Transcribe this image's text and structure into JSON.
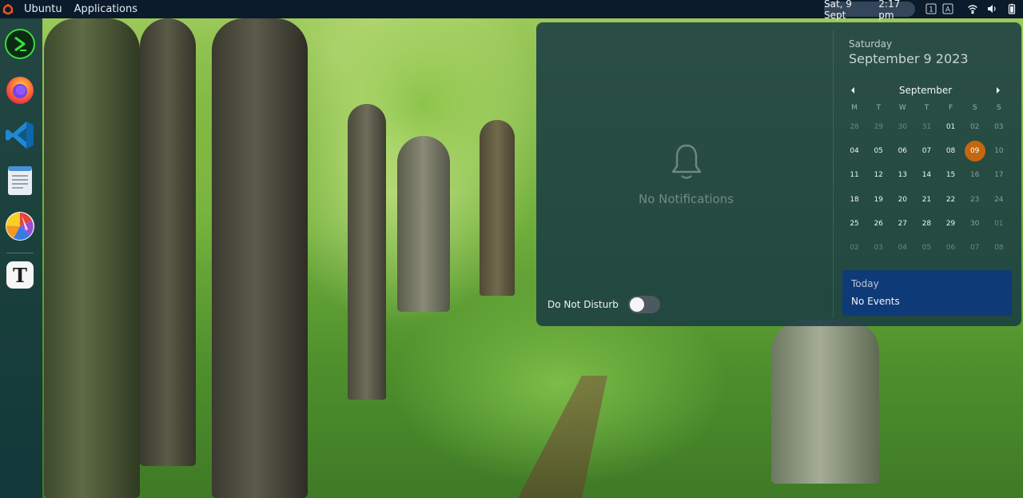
{
  "topbar": {
    "ubuntu_label": "Ubuntu",
    "applications_label": "Applications",
    "clock_date": "Sat, 9 Sept",
    "clock_time": "2:17 pm",
    "tray": {
      "workspace": "1",
      "input": "A"
    }
  },
  "dock": {
    "items": [
      {
        "name": "terminal-app",
        "icon": "terminal-icon"
      },
      {
        "name": "firefox-app",
        "icon": "firefox-icon"
      },
      {
        "name": "vscode-app",
        "icon": "vscode-icon"
      },
      {
        "name": "text-editor-app",
        "icon": "document-icon"
      },
      {
        "name": "color-picker-app",
        "icon": "color-wheel-icon"
      },
      {
        "name": "typora-app",
        "icon": "typora-icon",
        "glyph": "T"
      }
    ]
  },
  "notifications": {
    "empty_label": "No Notifications",
    "dnd_label": "Do Not Disturb",
    "dnd_enabled": false
  },
  "calendar": {
    "weekday": "Saturday",
    "full_date": "September 9 2023",
    "month": "September",
    "weekday_headers": [
      "M",
      "T",
      "W",
      "T",
      "F",
      "S",
      "S"
    ],
    "weeks": [
      [
        "28",
        "29",
        "30",
        "31",
        "01",
        "02",
        "03"
      ],
      [
        "04",
        "05",
        "06",
        "07",
        "08",
        "09",
        "10"
      ],
      [
        "11",
        "12",
        "13",
        "14",
        "15",
        "16",
        "17"
      ],
      [
        "18",
        "19",
        "20",
        "21",
        "22",
        "23",
        "24"
      ],
      [
        "25",
        "26",
        "27",
        "28",
        "29",
        "30",
        "01"
      ],
      [
        "02",
        "03",
        "04",
        "05",
        "06",
        "07",
        "08"
      ]
    ],
    "today": "09",
    "events_title": "Today",
    "events_empty": "No Events"
  },
  "colors": {
    "topbar": "#0b1b2b",
    "today_accent": "#c6660f",
    "events_panel": "#0f3a78"
  }
}
